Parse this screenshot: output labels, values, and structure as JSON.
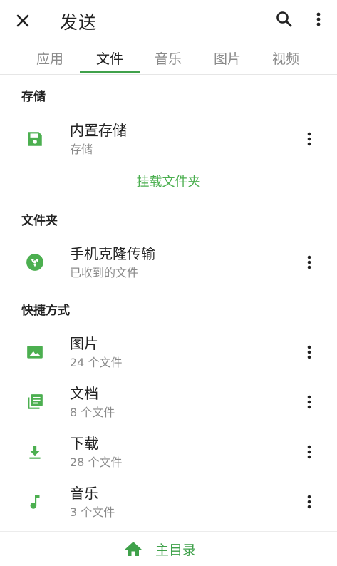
{
  "header": {
    "title": "发送",
    "close_icon": "close-icon",
    "search_icon": "search-icon",
    "more_icon": "more-vert-icon"
  },
  "tabs": [
    {
      "label": "应用",
      "active": false
    },
    {
      "label": "文件",
      "active": true
    },
    {
      "label": "音乐",
      "active": false
    },
    {
      "label": "图片",
      "active": false
    },
    {
      "label": "视频",
      "active": false
    }
  ],
  "sections": {
    "storage": {
      "title": "存储",
      "items": [
        {
          "name": "内置存储",
          "sub": "存储",
          "icon": "save-icon"
        }
      ],
      "mount_label": "挂载文件夹"
    },
    "folders": {
      "title": "文件夹",
      "items": [
        {
          "name": "手机克隆传输",
          "sub": "已收到的文件",
          "icon": "phone-clone-icon"
        }
      ]
    },
    "shortcuts": {
      "title": "快捷方式",
      "items": [
        {
          "name": "图片",
          "sub": "24 个文件",
          "icon": "image-icon"
        },
        {
          "name": "文档",
          "sub": "8 个文件",
          "icon": "library-books-icon"
        },
        {
          "name": "下载",
          "sub": "28 个文件",
          "icon": "download-icon"
        },
        {
          "name": "音乐",
          "sub": "3 个文件",
          "icon": "music-note-icon"
        }
      ]
    }
  },
  "bottom": {
    "label": "主目录",
    "icon": "home-icon"
  },
  "colors": {
    "accent": "#3fa14a",
    "icon_green": "#4caf50",
    "secondary_text": "#8a8a8a"
  }
}
